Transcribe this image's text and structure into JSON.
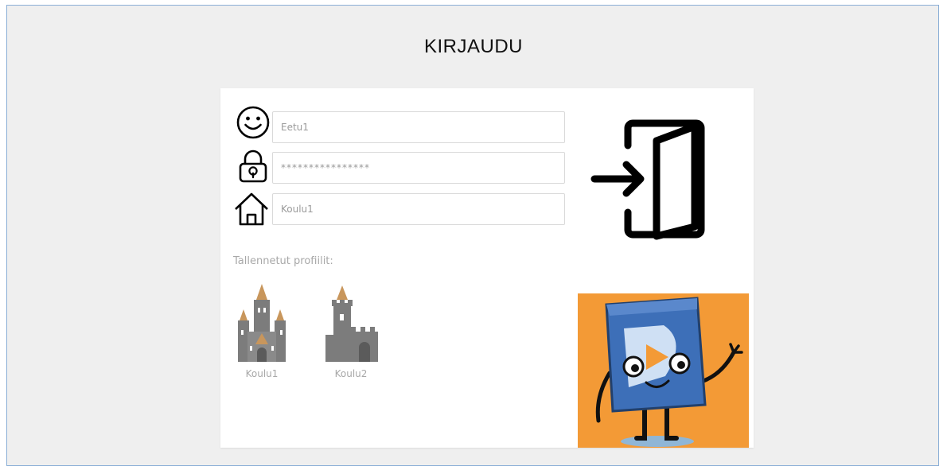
{
  "page": {
    "title": "KIRJAUDU"
  },
  "login_form": {
    "username_value": "Eetu1",
    "password_value": "****************",
    "school_value": "Koulu1"
  },
  "icons": {
    "username": "smiley-face-icon",
    "password": "padlock-icon",
    "school": "house-icon",
    "login": "door-enter-icon",
    "profile_castle": "castle-icon",
    "profile_tower": "tower-icon"
  },
  "saved_profiles": {
    "label": "Tallennetut profiilit:",
    "items": [
      {
        "name": "Koulu1",
        "icon": "castle-icon"
      },
      {
        "name": "Koulu2",
        "icon": "tower-icon"
      }
    ]
  },
  "colors": {
    "page_background": "#efefef",
    "frame_border": "#8aaed6",
    "panel_background": "#ffffff",
    "mascot_background": "#f39a36",
    "castle_stone": "#7c7c7c",
    "castle_roof": "#c8965c"
  }
}
